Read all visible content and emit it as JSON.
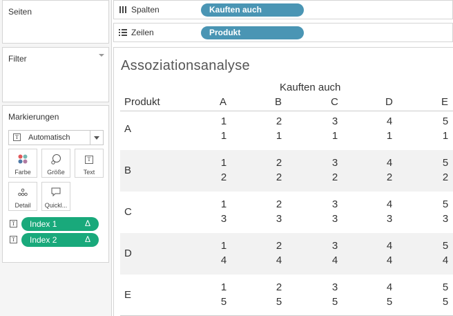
{
  "sidebar": {
    "pages_title": "Seiten",
    "filters_title": "Filter",
    "marks": {
      "title": "Markierungen",
      "mark_type": "Automatisch",
      "buttons": [
        {
          "label": "Farbe",
          "icon": "color-dots-icon"
        },
        {
          "label": "Größe",
          "icon": "size-bubbles-icon"
        },
        {
          "label": "Text",
          "icon": "text-t-icon"
        },
        {
          "label": "Detail",
          "icon": "detail-dots-icon"
        },
        {
          "label": "Quickl...",
          "icon": "tooltip-bubble-icon"
        }
      ],
      "fields": [
        {
          "label": "Index 1",
          "symbol": "Δ"
        },
        {
          "label": "Index 2",
          "symbol": "Δ"
        }
      ]
    }
  },
  "shelves": {
    "columns": {
      "label": "Spalten",
      "pill": "Kauften auch"
    },
    "rows": {
      "label": "Zeilen",
      "pill": "Produkt"
    }
  },
  "sheet": {
    "title": "Assoziationsanalyse",
    "column_group_title": "Kauften auch",
    "row_header_title": "Produkt",
    "columns": [
      "A",
      "B",
      "C",
      "D",
      "E"
    ],
    "rows": [
      {
        "label": "A",
        "top": [
          "1",
          "2",
          "3",
          "4",
          "5"
        ],
        "bottom": [
          "1",
          "1",
          "1",
          "1",
          "1"
        ]
      },
      {
        "label": "B",
        "top": [
          "1",
          "2",
          "3",
          "4",
          "5"
        ],
        "bottom": [
          "2",
          "2",
          "2",
          "2",
          "2"
        ]
      },
      {
        "label": "C",
        "top": [
          "1",
          "2",
          "3",
          "4",
          "5"
        ],
        "bottom": [
          "3",
          "3",
          "3",
          "3",
          "3"
        ]
      },
      {
        "label": "D",
        "top": [
          "1",
          "2",
          "3",
          "4",
          "5"
        ],
        "bottom": [
          "4",
          "4",
          "4",
          "4",
          "4"
        ]
      },
      {
        "label": "E",
        "top": [
          "1",
          "2",
          "3",
          "4",
          "5"
        ],
        "bottom": [
          "5",
          "5",
          "5",
          "5",
          "5"
        ]
      }
    ]
  },
  "colors": {
    "mark_pill": "#19a97b",
    "shelf_pill": "#4a95b4",
    "band": "#f2f2f2"
  }
}
